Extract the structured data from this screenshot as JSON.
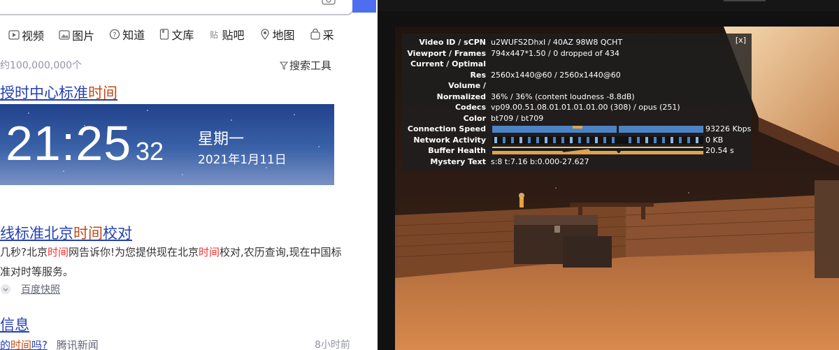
{
  "search_page": {
    "tabs": [
      {
        "label": "视频",
        "icon": "video-icon"
      },
      {
        "label": "图片",
        "icon": "image-icon"
      },
      {
        "label": "知道",
        "icon": "question-icon"
      },
      {
        "label": "文库",
        "icon": "document-icon"
      },
      {
        "label": "贴吧",
        "icon": "tieba-icon"
      },
      {
        "label": "地图",
        "icon": "map-pin-icon"
      },
      {
        "label": "采",
        "icon": "bag-icon"
      }
    ],
    "result_count": "约100,000,000个",
    "tools_label": "搜索工具",
    "result1": {
      "title_pre": "授时中心标准",
      "title_hl": "时间"
    },
    "clock": {
      "time": "21:25",
      "seconds": "32",
      "weekday": "星期一",
      "date": "2021年1月11日"
    },
    "result2": {
      "title_pre": "线标准北京",
      "title_hl": "时间",
      "title_post": "校对",
      "snippet_a": "几秒?北京",
      "snippet_hl1": "时间",
      "snippet_b": "网告诉你!为您提供现在北京",
      "snippet_hl2": "时间",
      "snippet_c": "校对,农历查询,现在中国标",
      "snippet_line2": "准对时等服务。",
      "snapshot": "百度快照"
    },
    "result3": {
      "title": "信息",
      "q_pre": "的",
      "q_hl": "时间",
      "q_post": "吗?",
      "source": "腾讯新闻",
      "time": "8小时前"
    }
  },
  "stats_for_nerds": {
    "close_label": "[x]",
    "rows": [
      {
        "key": "Video ID / sCPN",
        "value": "u2WUFS2DhxI / 40AZ 98W8 QCHT"
      },
      {
        "key": "Viewport / Frames",
        "value": "794x447*1.50 / 0 dropped of 434"
      },
      {
        "key": "Current / Optimal",
        "value": ""
      },
      {
        "key": "Res",
        "value": "2560x1440@60 / 2560x1440@60"
      },
      {
        "key": "Volume /",
        "value": ""
      },
      {
        "key": "Normalized",
        "value": "36% / 36% (content loudness -8.8dB)"
      },
      {
        "key": "Codecs",
        "value": "vp09.00.51.08.01.01.01.01.00 (308) / opus (251)"
      },
      {
        "key": "Color",
        "value": "bt709 / bt709"
      },
      {
        "key": "Connection Speed",
        "value": "93226 Kbps"
      },
      {
        "key": "Network Activity",
        "value": "0 KB"
      },
      {
        "key": "Buffer Health",
        "value": "20.54 s"
      },
      {
        "key": "Mystery Text",
        "value": "s:8 t:7.16 b:0.000-27.627"
      }
    ]
  },
  "colors": {
    "link": "#2440b3",
    "highlight": "#c14a15",
    "graph_blue": "#4c83c4",
    "graph_orange": "#e0a24e"
  }
}
